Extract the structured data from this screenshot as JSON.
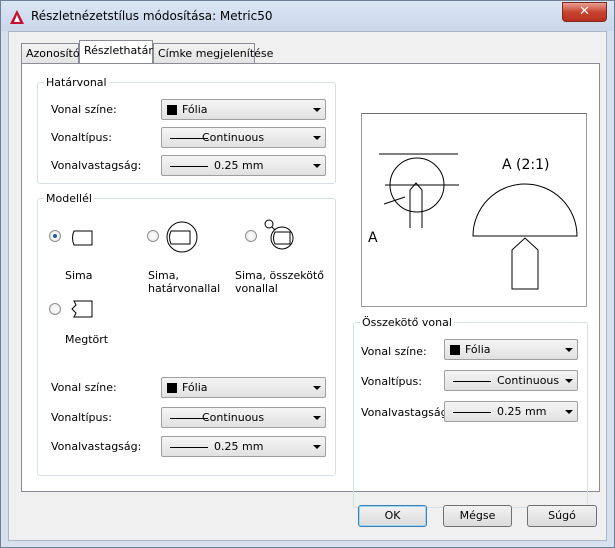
{
  "window": {
    "title": "Részletnézetstílus módosítása: Metric50",
    "close_label": "✕"
  },
  "tabs": [
    {
      "label": "Azonosító"
    },
    {
      "label": "Részlethatár"
    },
    {
      "label": "Címke megjelenítése"
    }
  ],
  "boundary": {
    "group_title": "Határvonal",
    "color_label": "Vonal színe:",
    "color_value": "Fólia",
    "linetype_label": "Vonaltípus:",
    "linetype_value": "Continuous",
    "lineweight_label": "Vonalvastagság:",
    "lineweight_value": "0.25 mm"
  },
  "model_edge": {
    "group_title": "Modellél",
    "options": [
      {
        "label": "Sima",
        "selected": true
      },
      {
        "label": "Sima,\nhatárvonallal",
        "selected": false
      },
      {
        "label": "Sima, összekötő\nvonallal",
        "selected": false
      },
      {
        "label": "Megtört",
        "selected": false
      }
    ],
    "color_label": "Vonal színe:",
    "color_value": "Fólia",
    "linetype_label": "Vonaltípus:",
    "linetype_value": "Continuous",
    "lineweight_label": "Vonalvastagság:",
    "lineweight_value": "0.25 mm"
  },
  "preview": {
    "view_label": "A (2:1)",
    "marker_label": "A"
  },
  "connection": {
    "group_title": "Összekötő vonal",
    "color_label": "Vonal színe:",
    "color_value": "Fólia",
    "linetype_label": "Vonaltípus:",
    "linetype_value": "Continuous",
    "lineweight_label": "Vonalvastagság:",
    "lineweight_value": "0.25 mm"
  },
  "buttons": {
    "ok": "OK",
    "cancel": "Mégse",
    "help": "Súgó"
  }
}
